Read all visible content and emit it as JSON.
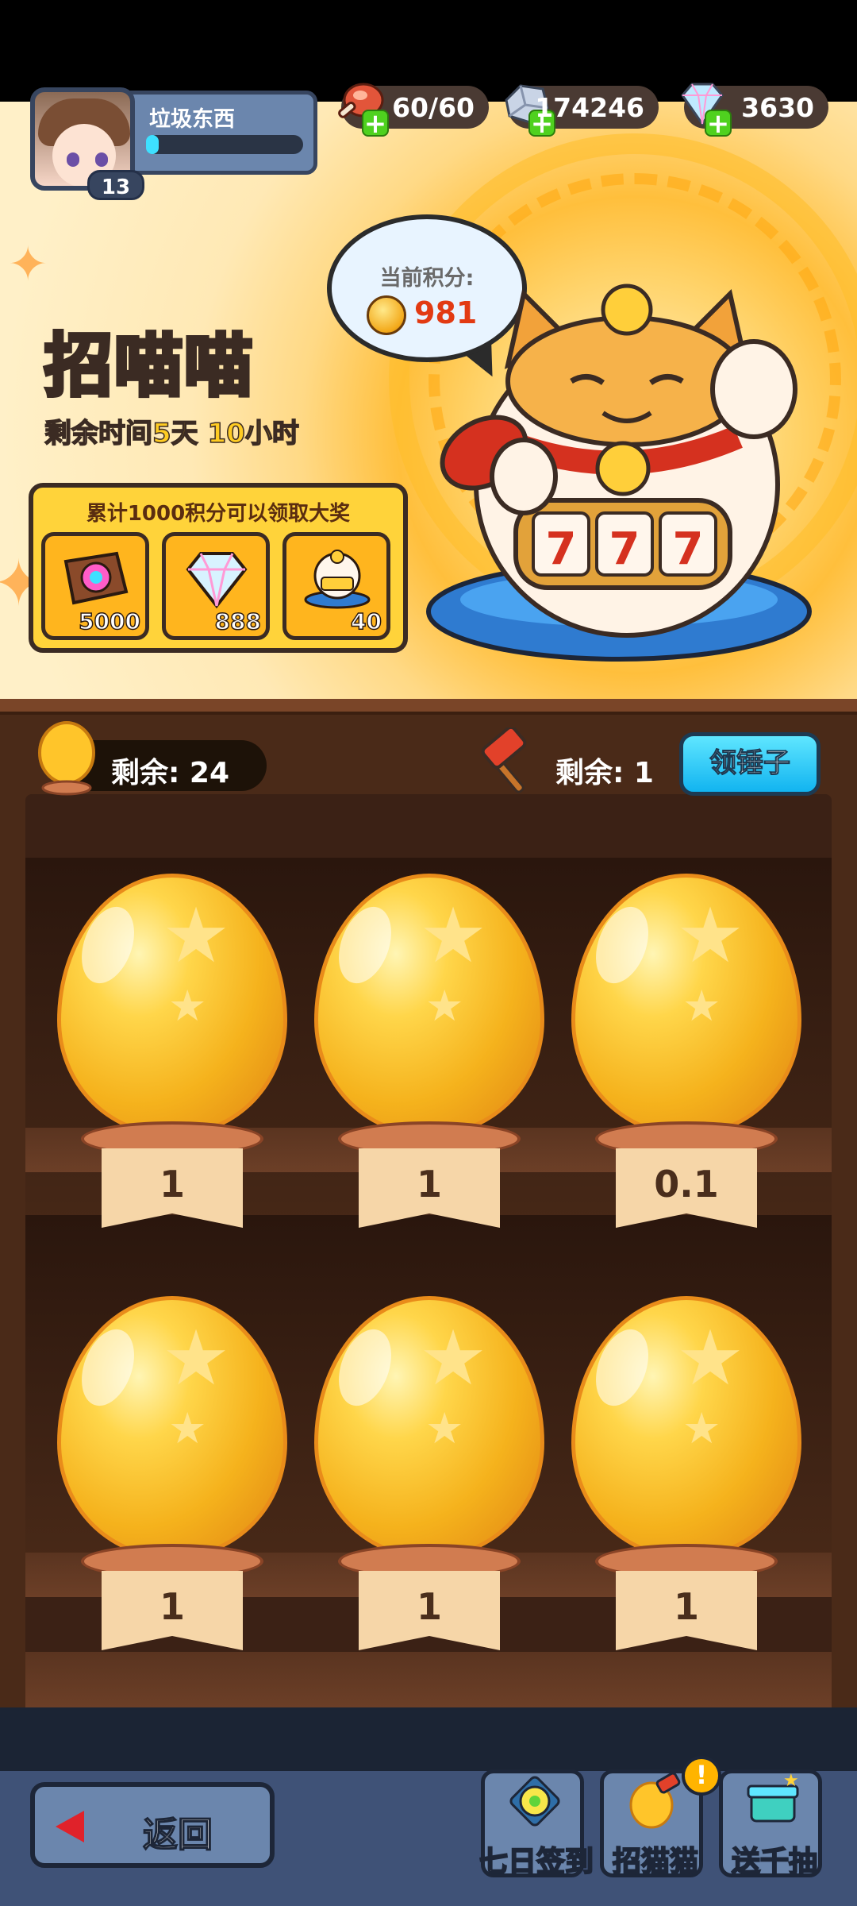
{
  "player": {
    "name": "垃圾东西",
    "level": "13",
    "xp_fraction": 0.08
  },
  "resources": [
    {
      "icon": "meat-icon",
      "value": "60/60"
    },
    {
      "icon": "silver-ore-icon",
      "value": "174246"
    },
    {
      "icon": "diamond-icon",
      "value": "3630"
    }
  ],
  "event": {
    "title": "招喵喵",
    "time_prefix": "剩余时间",
    "days": "5天",
    "hours": "10小时"
  },
  "score": {
    "label": "当前积分:",
    "value": "981"
  },
  "reward_panel": {
    "title": "累计1000积分可以领取大奖",
    "items": [
      {
        "icon": "ticket-icon",
        "qty": "5000"
      },
      {
        "icon": "diamond-icon",
        "qty": "888"
      },
      {
        "icon": "lucky-cat-icon",
        "qty": "40"
      }
    ]
  },
  "counters": {
    "eggs_label": "剩余: 24",
    "hammer_label": "剩余: 1",
    "get_hammer": "领锤子"
  },
  "eggs": [
    "1",
    "1",
    "0.1",
    "1",
    "1",
    "1"
  ],
  "bottom": {
    "back": "返回",
    "nav": [
      {
        "icon": "clover-icon",
        "label": "七日签到",
        "badge": ""
      },
      {
        "icon": "golden-egg-hammer-icon",
        "label": "招猫猫",
        "badge": "!"
      },
      {
        "icon": "gift-chest-icon",
        "label": "送千抽",
        "badge": ""
      }
    ]
  },
  "colors": {
    "accent": "#ffd33a",
    "score_red": "#e23a12",
    "button_blue": "#12b4f0",
    "panel_blue": "#6b86ad"
  }
}
